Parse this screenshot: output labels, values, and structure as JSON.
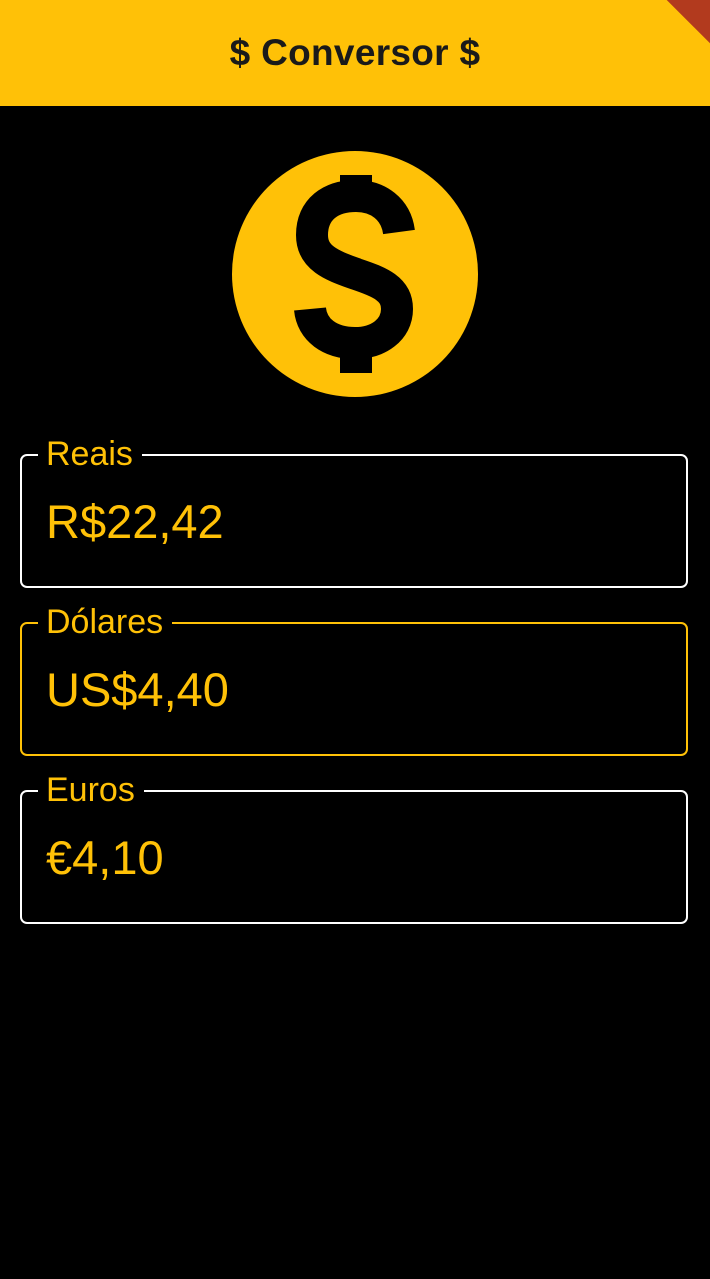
{
  "appbar": {
    "title": "$ Conversor $",
    "background": "#FFC107"
  },
  "icon": {
    "name": "monetization-icon",
    "color": "#FFC107"
  },
  "fields": [
    {
      "label": "Reais",
      "value": "R$22,42",
      "focused": false
    },
    {
      "label": "Dólares",
      "value": "US$4,40",
      "focused": true
    },
    {
      "label": "Euros",
      "value": "€4,10",
      "focused": false
    }
  ],
  "colors": {
    "accent": "#FFC107",
    "background": "#000000",
    "border": "#FFFFFF",
    "debug_banner": "#B23A1E"
  }
}
